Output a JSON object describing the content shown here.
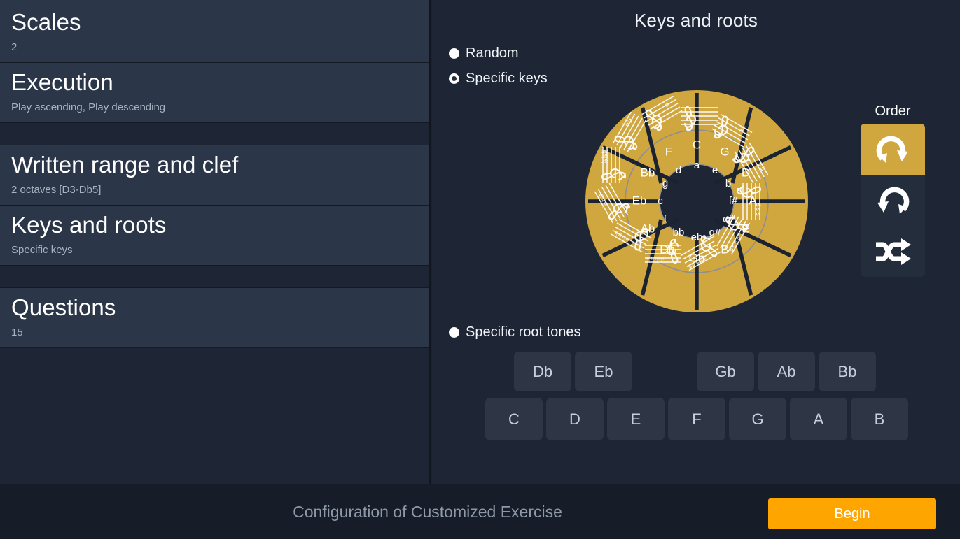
{
  "sidebar": {
    "items": [
      {
        "title": "Scales",
        "subtitle": "2"
      },
      {
        "title": "Execution",
        "subtitle": "Play ascending, Play descending"
      },
      {
        "title": "Written range and clef",
        "subtitle": "2 octaves [D3-Db5]"
      },
      {
        "title": "Keys and roots",
        "subtitle": "Specific keys"
      },
      {
        "title": "Questions",
        "subtitle": "15"
      }
    ]
  },
  "main": {
    "panel_title": "Keys and roots",
    "options": [
      {
        "label": "Random",
        "selected": false
      },
      {
        "label": "Specific keys",
        "selected": true
      }
    ],
    "root_option": {
      "label": "Specific root tones",
      "selected": false
    },
    "order": {
      "title": "Order",
      "buttons": [
        {
          "icon": "rotate-clockwise-icon",
          "active": true
        },
        {
          "icon": "rotate-counterclockwise-icon",
          "active": false
        },
        {
          "icon": "shuffle-icon",
          "active": false
        }
      ]
    },
    "root_tones": {
      "black_keys": [
        "Db",
        "Eb",
        "",
        "Gb",
        "Ab",
        "Bb"
      ],
      "white_keys": [
        "C",
        "D",
        "E",
        "F",
        "G",
        "A",
        "B"
      ]
    }
  },
  "circle_of_fifths": {
    "major_keys": [
      "C",
      "G",
      "D",
      "A",
      "E",
      "B",
      "Gb",
      "Db",
      "Ab",
      "Eb",
      "Bb",
      "F"
    ],
    "minor_keys": [
      "a",
      "e",
      "b",
      "f#",
      "c#",
      "g#",
      "eb",
      "bb",
      "f",
      "c",
      "g",
      "d"
    ],
    "outer_ring_content": "treble clef key signatures"
  },
  "footer": {
    "caption": "Configuration of Customized Exercise",
    "begin_label": "Begin"
  },
  "colors": {
    "background": "#1e2636",
    "sidebar_item": "#2b3749",
    "gold": "#d0a63e",
    "accent_orange": "#ffa500",
    "button": "#2e3646"
  }
}
